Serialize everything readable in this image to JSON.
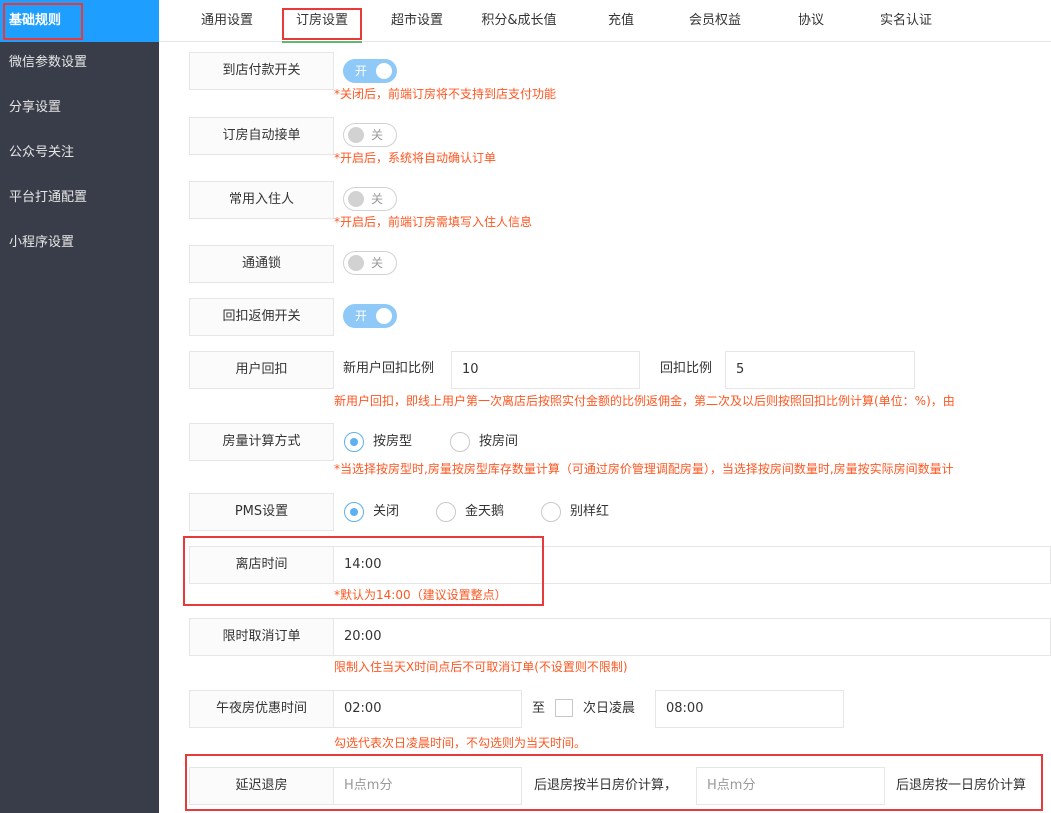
{
  "sidebar": {
    "items": [
      {
        "label": "基础规则"
      },
      {
        "label": "微信参数设置"
      },
      {
        "label": "分享设置"
      },
      {
        "label": "公众号关注"
      },
      {
        "label": "平台打通配置"
      },
      {
        "label": "小程序设置"
      }
    ]
  },
  "tabs": [
    {
      "label": "通用设置"
    },
    {
      "label": "订房设置"
    },
    {
      "label": "超市设置"
    },
    {
      "label": "积分&成长值"
    },
    {
      "label": "充值"
    },
    {
      "label": "会员权益"
    },
    {
      "label": "协议"
    },
    {
      "label": "实名认证"
    }
  ],
  "form": {
    "pay_at_store": {
      "label": "到店付款开关",
      "switch": "开",
      "hint": "*关闭后，前端订房将不支持到店支付功能"
    },
    "auto_accept": {
      "label": "订房自动接单",
      "switch": "关",
      "hint": "*开启后，系统将自动确认订单"
    },
    "frequent_guest": {
      "label": "常用入住人",
      "switch": "关",
      "hint": "*开启后，前端订房需填写入住人信息"
    },
    "ttlock": {
      "label": "通通锁",
      "switch": "关"
    },
    "rebate_switch": {
      "label": "回扣返佣开关",
      "switch": "开"
    },
    "user_rebate": {
      "label": "用户回扣",
      "new_user_label": "新用户回扣比例",
      "new_user_value": "10",
      "ratio_label": "回扣比例",
      "ratio_value": "5",
      "hint": "新用户回扣，即线上用户第一次离店后按照实付金额的比例返佣金，第二次及以后则按照回扣比例计算(单位：%)，由"
    },
    "room_calc": {
      "label": "房量计算方式",
      "options": [
        "按房型",
        "按房间"
      ],
      "hint": "*当选择按房型时,房量按房型库存数量计算（可通过房价管理调配房量），当选择按房间数量时,房量按实际房间数量计"
    },
    "pms": {
      "label": "PMS设置",
      "options": [
        "关闭",
        "金天鹅",
        "别样红"
      ]
    },
    "checkout_time": {
      "label": "离店时间",
      "value": "14:00",
      "hint": "*默认为14:00（建议设置整点）"
    },
    "cancel_deadline": {
      "label": "限时取消订单",
      "value": "20:00",
      "hint": "限制入住当天X时间点后不可取消订单(不设置则不限制)"
    },
    "midnight": {
      "label": "午夜房优惠时间",
      "start": "02:00",
      "to": "至",
      "next_day": "次日凌晨",
      "end": "08:00",
      "hint": "勾选代表次日凌晨时间，不勾选则为当天时间。"
    },
    "late_checkout": {
      "label": "延迟退房",
      "placeholder1": "H点m分",
      "text1": "后退房按半日房价计算，",
      "placeholder2": "H点m分",
      "text2": "后退房按一日房价计算"
    }
  },
  "colors": {
    "sidebar_bg": "#393d49",
    "active_blue": "#1e9fff",
    "hint_red": "#ff5722",
    "highlight_red": "#e83a3a"
  }
}
